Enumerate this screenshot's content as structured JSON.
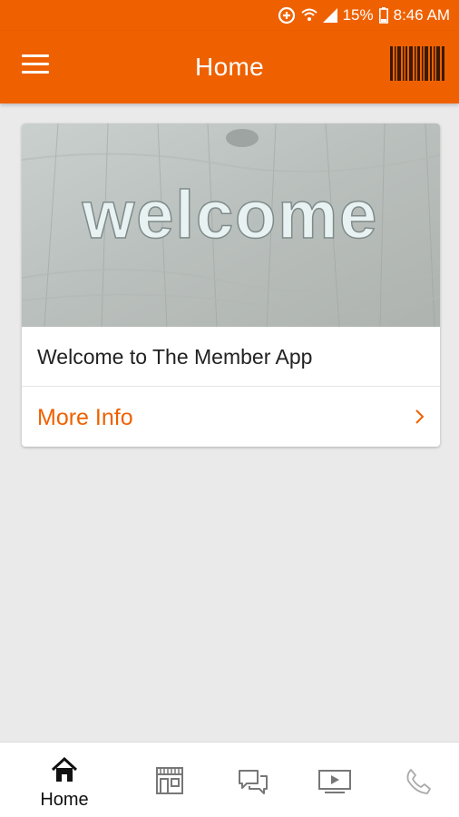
{
  "status_bar": {
    "battery": "15%",
    "time": "8:46 AM"
  },
  "app_bar": {
    "title": "Home",
    "menu_icon": "hamburger-menu-icon",
    "barcode_icon": "barcode-icon"
  },
  "card": {
    "image_word": "welcome",
    "title": "Welcome to The Member App",
    "link_label": "More Info",
    "link_icon": "chevron-right-icon"
  },
  "tabs": [
    {
      "label": "Home",
      "icon": "home-icon",
      "active": true
    },
    {
      "label": "",
      "icon": "store-icon"
    },
    {
      "label": "",
      "icon": "chat-icon"
    },
    {
      "label": "",
      "icon": "video-icon"
    },
    {
      "label": "",
      "icon": "phone-icon"
    }
  ],
  "colors": {
    "brand": "#ef6100",
    "background": "#ebeaea"
  }
}
